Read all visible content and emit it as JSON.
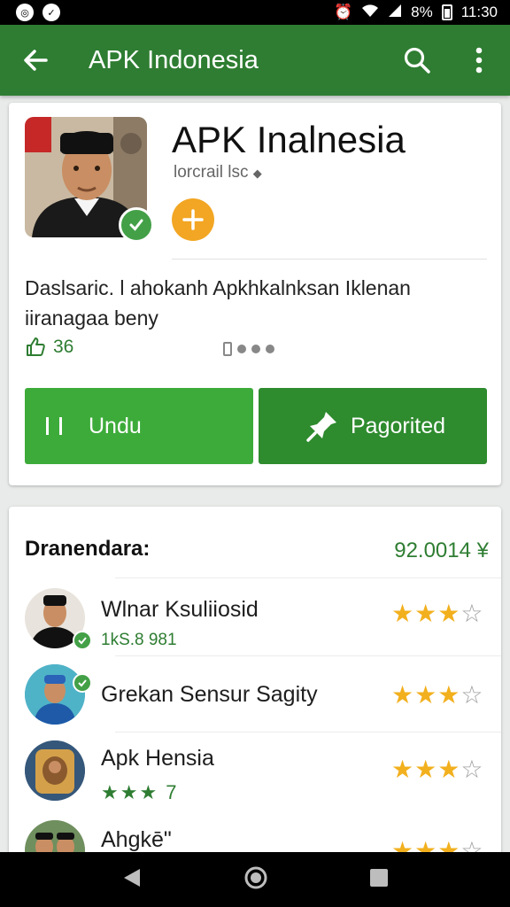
{
  "status_bar": {
    "battery_text": "8%",
    "time": "11:30"
  },
  "app_bar": {
    "title": "APK Indonesia",
    "back_icon": "arrow-left-icon",
    "search_icon": "search-icon",
    "menu_icon": "more-vert-icon"
  },
  "app_card": {
    "name": "APK Inalnesia",
    "subtitle": "lorcrail lsc",
    "description": "Daslsaric. l ahokanh Apkhkalnksan Iklenan iiranagaa beny",
    "likes": "36",
    "download_label": "Undu",
    "secondary_label": "Pagorited",
    "colors": {
      "primary": "#2e7d32",
      "download": "#3dab3a",
      "accent": "#f2a623"
    }
  },
  "list_card": {
    "header": "Dranendara:",
    "price": "92.0014 ¥",
    "items": [
      {
        "title": "Wlnar Ksuliiosid",
        "subtitle": "1kS.8 981",
        "rating": 3,
        "max": 4
      },
      {
        "title": "Grekan Sensur Sagity",
        "subtitle": "",
        "rating": 3,
        "max": 4
      },
      {
        "title": "Apk Hensia",
        "subtitle": "★★★ 7",
        "rating": 3,
        "max": 4
      },
      {
        "title": "Ahgkē\"",
        "subtitle": "",
        "rating": 3,
        "max": 4
      }
    ]
  }
}
